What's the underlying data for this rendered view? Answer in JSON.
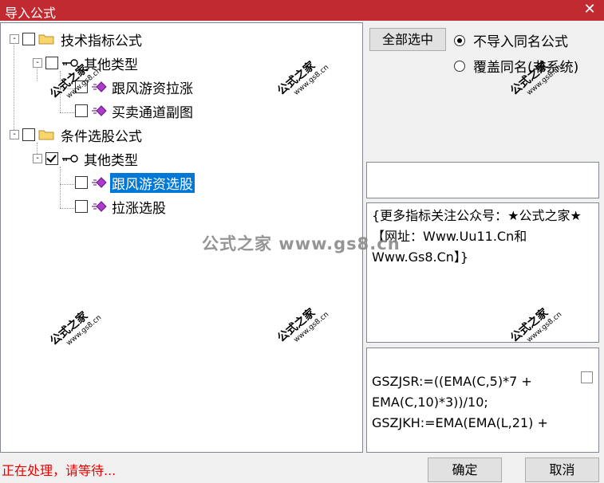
{
  "window": {
    "title": "导入公式",
    "close_glyph": "✕"
  },
  "tree": {
    "expand_glyph": "-",
    "group1": {
      "label": "技术指标公式",
      "sub": {
        "label": "其他类型",
        "items": [
          "跟风游资拉涨",
          "买卖通道副图"
        ]
      }
    },
    "group2": {
      "label": "条件选股公式",
      "sub": {
        "label": "其他类型",
        "items": [
          "跟风游资选股",
          "拉涨选股"
        ]
      }
    }
  },
  "buttons": {
    "select_all": "全部选中",
    "ok": "确定",
    "cancel": "取消"
  },
  "options": {
    "no_import": "不导入同名公式",
    "overwrite": "覆盖同名(非系统)",
    "selected": "no_import"
  },
  "description": "{更多指标关注公众号：★公式之家★ 【网址：Www.Uu11.Cn和Www.Gs8.Cn】}",
  "formula_lines": [
    "GSZJSR:=((EMA(C,5)*7 +",
    "EMA(C,10)*3))/10;",
    "GSZJKH:=EMA(EMA(L,21) +"
  ],
  "status": "正在处理，请等待...",
  "watermarks": {
    "text": "公式之家",
    "url": "www.gs8.cn",
    "banner": "公式之家 www.gs8.cn"
  }
}
